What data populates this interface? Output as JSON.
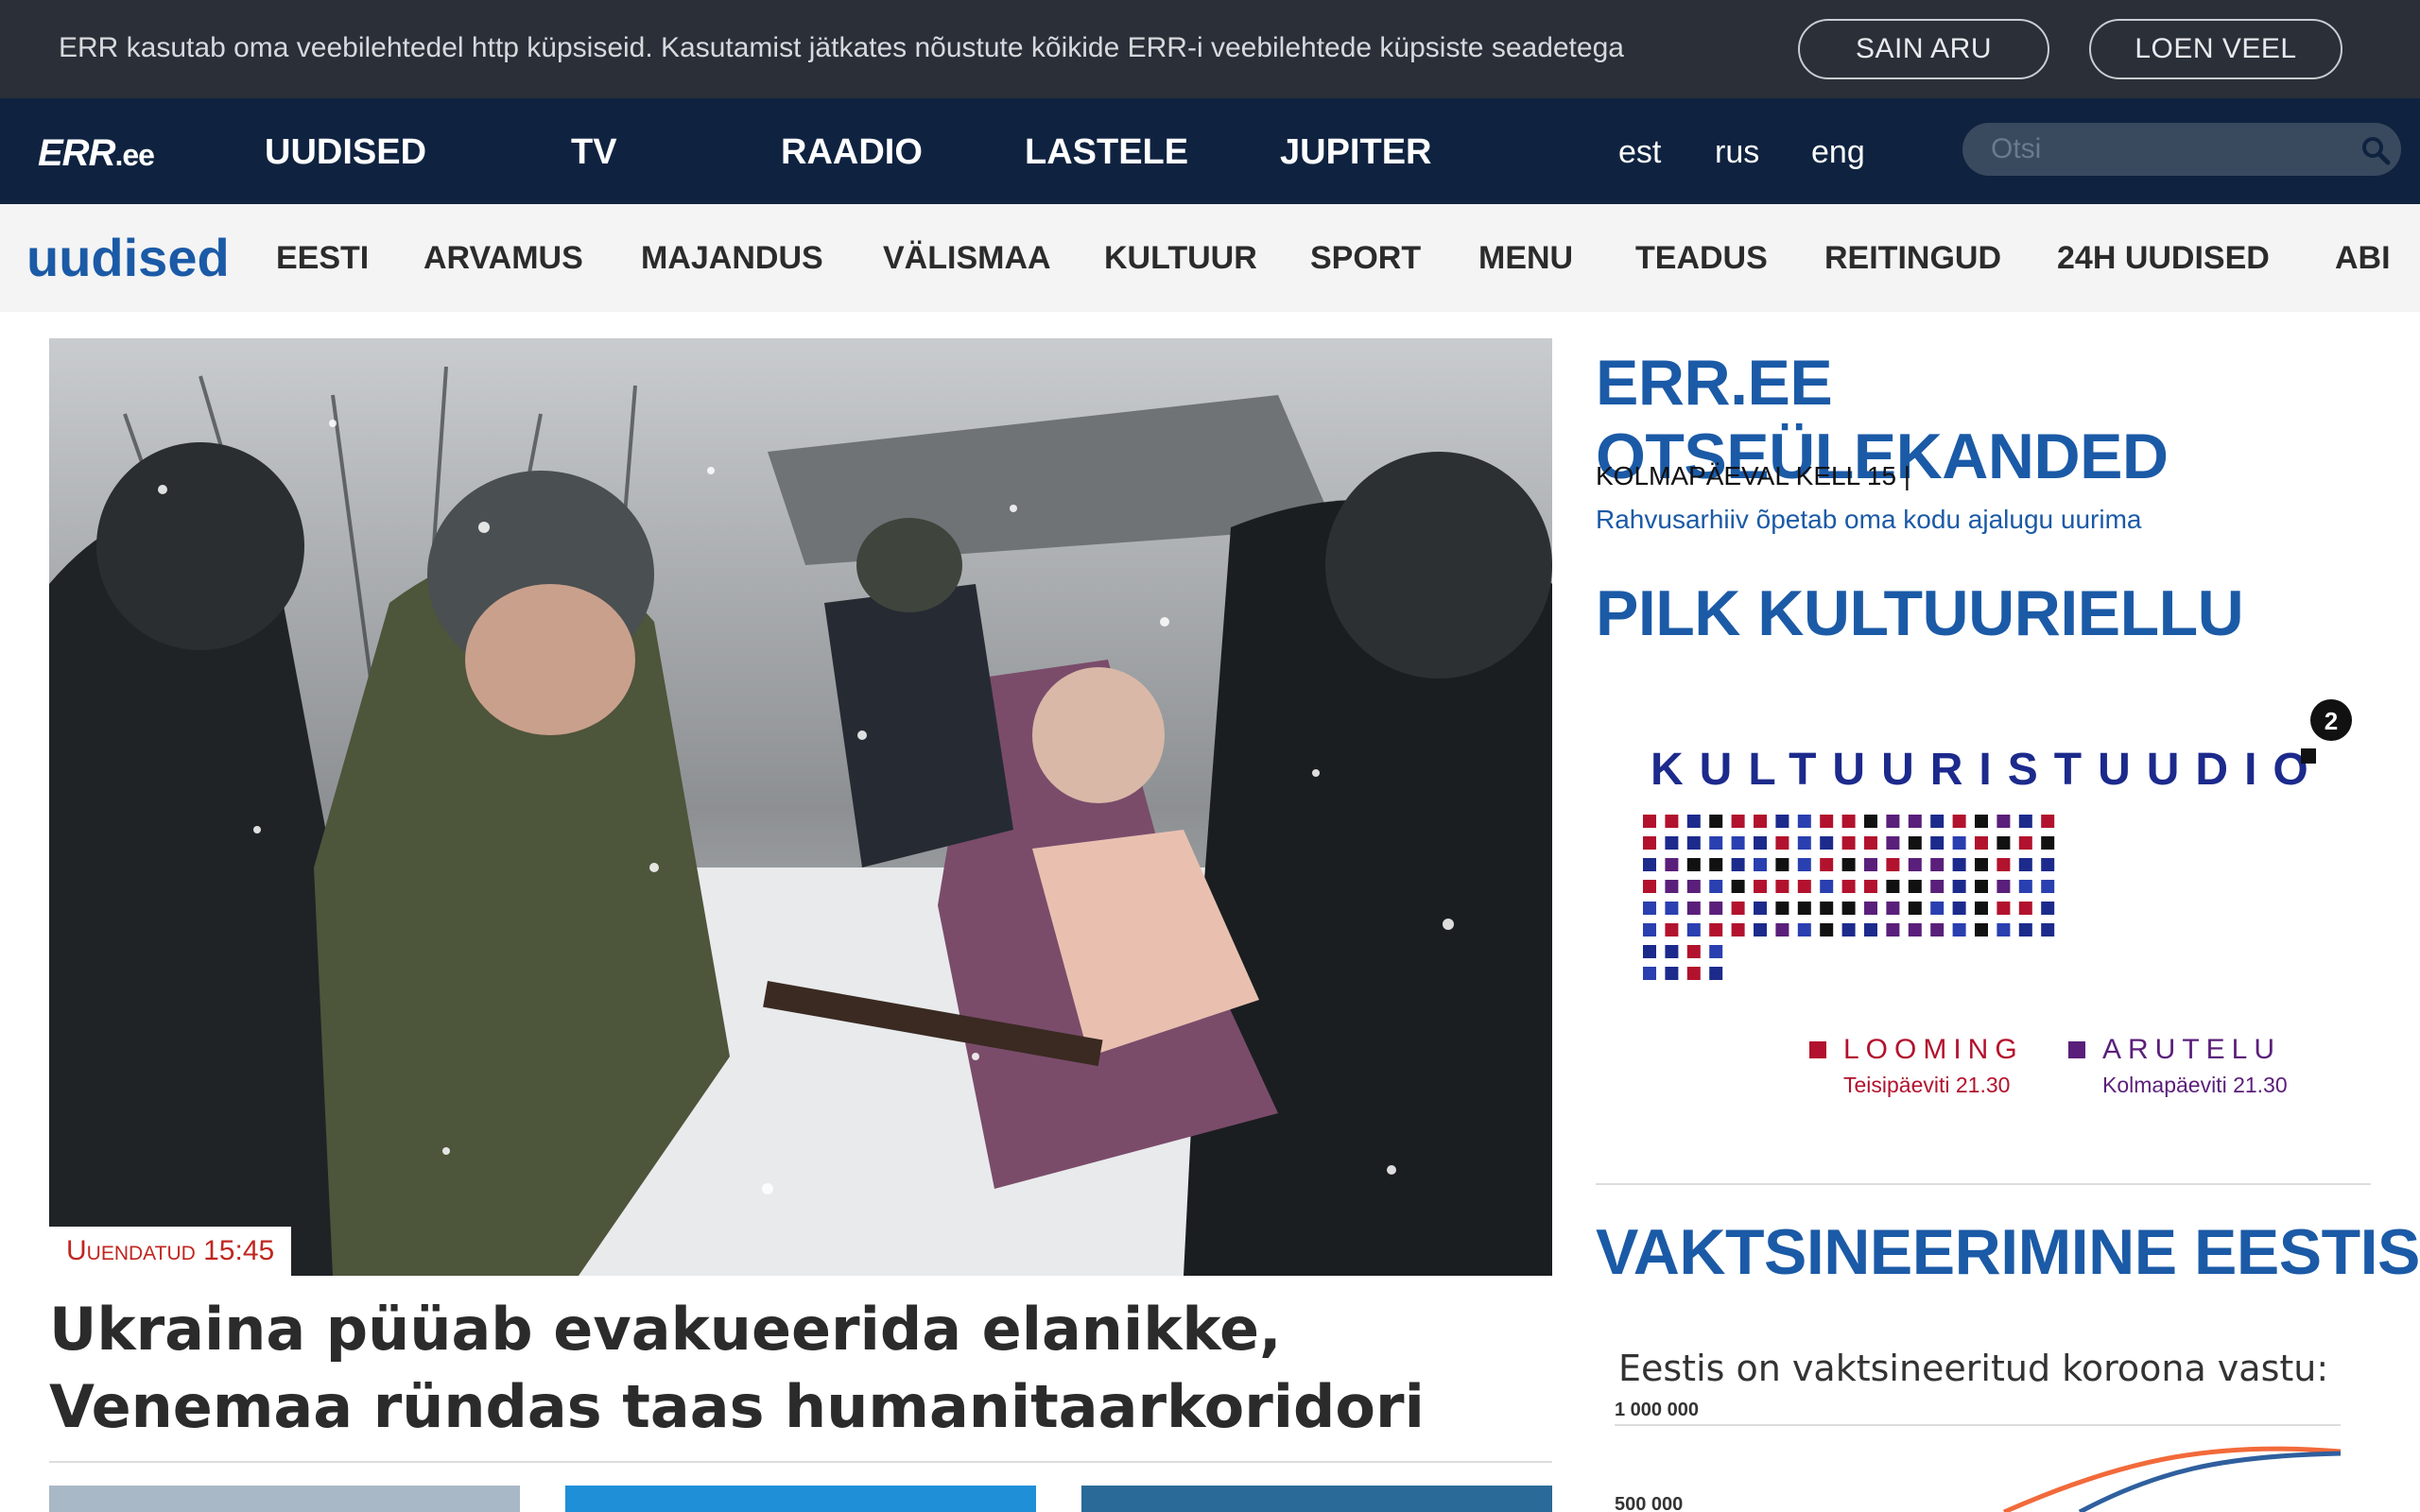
{
  "cookie": {
    "text": "ERR kasutab oma veebilehtedel http küpsiseid. Kasutamist jätkates nõustute kõikide ERR-i veebilehtede küpsiste seadetega",
    "accept_label": "SAIN ARU",
    "more_label": "LOEN VEEL"
  },
  "topnav": {
    "logo_main": "ERR",
    "logo_suffix": ".ee",
    "items": [
      "UUDISED",
      "TV",
      "RAADIO",
      "LASTELE",
      "JUPITER"
    ],
    "languages": [
      "est",
      "rus",
      "eng"
    ],
    "search_placeholder": "Otsi",
    "search_icon": "magnifier-icon"
  },
  "subnav": {
    "section_logo": "uudised",
    "items": [
      "EESTI",
      "ARVAMUS",
      "MAJANDUS",
      "VÄLISMAA",
      "KULTUUR",
      "SPORT",
      "MENU",
      "TEADUS",
      "REITINGUD",
      "24H UUDISED",
      "ABI"
    ]
  },
  "article": {
    "updated": "Uuendatud 15:45",
    "headline": "Ukraina püüab evakueerida elanikke, Venemaa ründas taas humanitaarkoridori"
  },
  "sidebar": {
    "live_heading": "ERR.EE OTSEÜLEKANDED",
    "live_time": "KOLMAPÄEVAL KELL 15 |",
    "live_title": "Rahvusarhiiv õpetab oma kodu ajalugu uurima",
    "culture_heading": "PILK KULTUURIELLU",
    "promo": {
      "title": "KULTUURISTUUDIO",
      "label_a": "LOOMING",
      "label_b": "ARUTELU",
      "time_a": "Teisipäeviti 21.30",
      "time_b": "Kolmapäeviti 21.30",
      "channel": "2"
    },
    "vacc_heading": "VAKTSINEERIMINE EESTIS",
    "vacc_title": "Eestis on vaktsineeritud koroona vastu:",
    "vacc_axis_top": "1 000 000",
    "vacc_axis_mid": "500 000"
  },
  "colors": {
    "brand_blue": "#1b5aa6",
    "nav_dark": "#0f2340",
    "cookie_bg": "#2a2f38",
    "badge_red": "#c0261f"
  }
}
